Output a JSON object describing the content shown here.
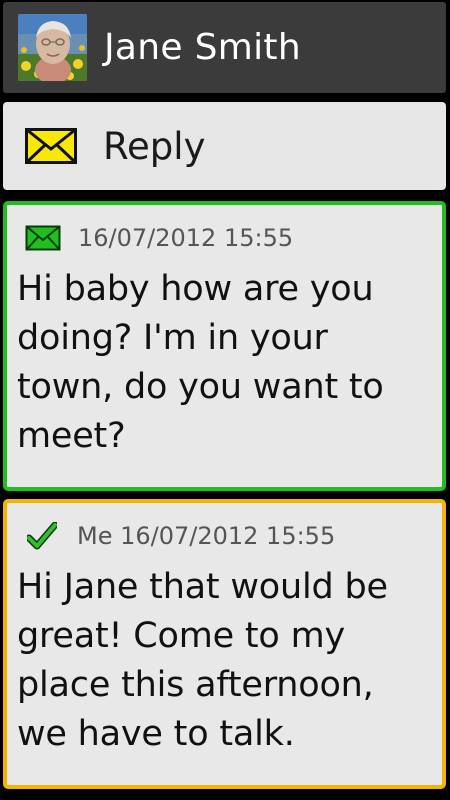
{
  "header": {
    "contact_name": "Jane Smith",
    "avatar_icon": "contact-photo"
  },
  "reply": {
    "label": "Reply",
    "icon": "envelope-icon",
    "icon_color": "#f7e70a"
  },
  "messages": [
    {
      "direction": "incoming",
      "icon": "envelope-icon",
      "icon_color": "#1fbf1f",
      "meta": "16/07/2012 15:55",
      "text": "Hi baby how are you doing? I'm in your town, do you want to meet?",
      "border_color": "#1fbf1f"
    },
    {
      "direction": "outgoing",
      "icon": "checkmark-icon",
      "icon_color": "#1fa51f",
      "meta": "Me 16/07/2012 15:55",
      "text": "Hi Jane that would be great! Come to my place this afternoon, we have to talk.",
      "border_color": "#f4b400"
    }
  ]
}
